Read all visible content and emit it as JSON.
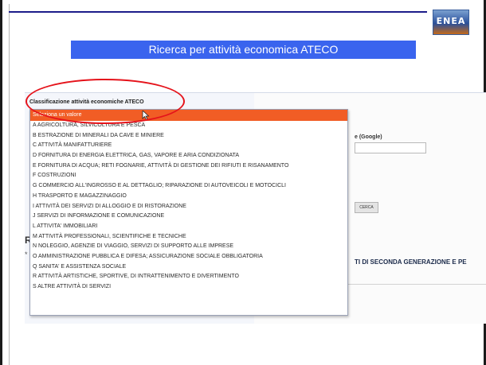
{
  "slide": {
    "title": "Ricerca per attività economica ATECO",
    "logo_text": "ENEA"
  },
  "screen": {
    "field_label": "Classificazione attività economiche ATECO",
    "google_label": "e (Google)",
    "search_button": "CERCA",
    "side_letter": "R",
    "side_letter2": "*",
    "right_text": "TI DI SECONDA GENERAZIONE E PE"
  },
  "dropdown": {
    "selected": "Seleziona un valore",
    "items": [
      "A AGRICOLTURA, SILVICOLTURA E PESCA",
      "B ESTRAZIONE DI MINERALI DA CAVE E MINIERE",
      "C ATTIVITÀ MANIFATTURIERE",
      "D FORNITURA DI ENERGIA ELETTRICA, GAS, VAPORE E ARIA CONDIZIONATA",
      "E FORNITURA DI ACQUA; RETI FOGNARIE, ATTIVITÀ DI GESTIONE DEI RIFIUTI E RISANAMENTO",
      "F COSTRUZIONI",
      "G COMMERCIO ALL'INGROSSO E AL DETTAGLIO; RIPARAZIONE DI AUTOVEICOLI E MOTOCICLI",
      "H TRASPORTO E MAGAZZINAGGIO",
      "I ATTIVITÀ DEI SERVIZI DI ALLOGGIO E DI RISTORAZIONE",
      "J SERVIZI DI INFORMAZIONE E COMUNICAZIONE",
      "L ATTIVITA' IMMOBILIARI",
      "M ATTIVITÀ PROFESSIONALI, SCIENTIFICHE E TECNICHE",
      "N NOLEGGIO, AGENZIE DI VIAGGIO, SERVIZI DI SUPPORTO ALLE IMPRESE",
      "O AMMINISTRAZIONE PUBBLICA E DIFESA; ASSICURAZIONE SOCIALE OBBLIGATORIA",
      "Q SANITA' E ASSISTENZA SOCIALE",
      "R ATTIVITÀ ARTISTICHE, SPORTIVE, DI INTRATTENIMENTO E DIVERTIMENTO",
      "S ALTRE ATTIVITÀ DI SERVIZI"
    ]
  },
  "colors": {
    "title_bg": "#3a64ee",
    "dropdown_highlight": "#f15d25",
    "annotation": "#e5131b"
  },
  "icons": {
    "cursor": "mouse-pointer-icon"
  }
}
